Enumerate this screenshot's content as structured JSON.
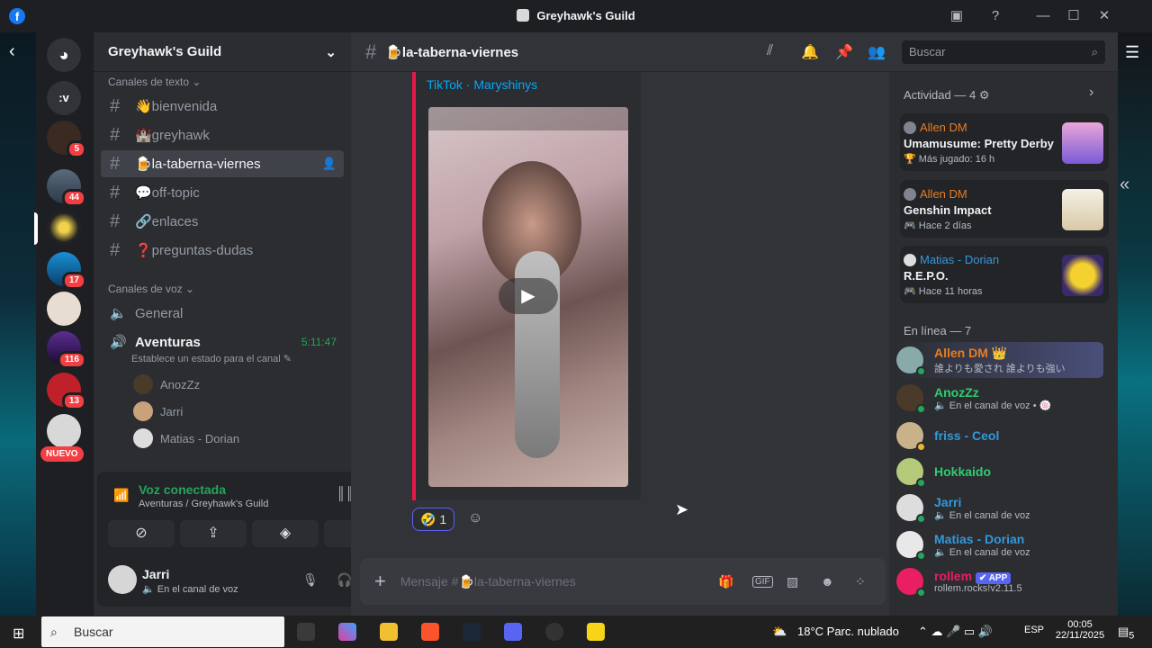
{
  "window": {
    "title": "Greyhawk's Guild",
    "fb": "f"
  },
  "guilds": {
    "home_label": ":v",
    "badges": [
      "5",
      "44",
      "17",
      "116",
      "13"
    ],
    "new_label": "NUEVO"
  },
  "sidebar": {
    "guild_name": "Greyhawk's Guild",
    "text_category": "Canales de texto",
    "text_channels": [
      "👋bienvenida",
      "🏰greyhawk",
      "🍺la-taberna-viernes",
      "💬off-topic",
      "🔗enlaces",
      "❓preguntas-dudas"
    ],
    "voice_category": "Canales de voz",
    "voice_channels": [
      "General",
      "Aventuras"
    ],
    "voice_timer": "5:11:47",
    "voice_status": "Establece un estado para el canal",
    "voice_users": [
      "AnozZz",
      "Jarri",
      "Matias - Dorian"
    ],
    "voice_connected": "Voz conectada",
    "voice_location": "Aventuras / Greyhawk's Guild",
    "user_name": "Jarri",
    "user_status": "En el canal de voz"
  },
  "header": {
    "channel": "🍺la-taberna-viernes",
    "search_placeholder": "Buscar"
  },
  "message": {
    "embed_provider": "TikTok · Maryshinys",
    "reaction_emoji": "🤣",
    "reaction_count": "1",
    "composer_placeholder": "Mensaje #🍺la-taberna-viernes"
  },
  "activity": {
    "title": "Actividad — 4",
    "items": [
      {
        "user": "Allen DM",
        "title": "Umamusume: Pretty Derby",
        "sub": "🏆 Más jugado: 16 h"
      },
      {
        "user": "Allen DM",
        "title": "Genshin Impact",
        "sub": "🎮 Hace 2 días"
      },
      {
        "user": "Matias - Dorian",
        "title": "R.E.P.O.",
        "sub": "🎮 Hace 11 horas"
      }
    ]
  },
  "online": {
    "title": "En línea — 7",
    "members": [
      {
        "name": "Allen DM 👑",
        "sub": "誰よりも愛され 誰よりも強い",
        "color": "#e67e22"
      },
      {
        "name": "AnozZz",
        "sub": "🔈 En el canal de voz • 🍥",
        "color": "#2ecc71"
      },
      {
        "name": "friss - Ceol",
        "sub": "",
        "color": "#3498db"
      },
      {
        "name": "Hokkaido",
        "sub": "",
        "color": "#2ecc71"
      },
      {
        "name": "Jarri",
        "sub": "🔈 En el canal de voz",
        "color": "#3498db"
      },
      {
        "name": "Matias - Dorian",
        "sub": "🔈 En el canal de voz",
        "color": "#3498db"
      },
      {
        "name": "rollem",
        "sub": "rollem.rocks!v2.11.5",
        "color": "#e91e63",
        "tag": "✔ APP"
      }
    ]
  },
  "taskbar": {
    "search": "Buscar",
    "weather": "18°C  Parc. nublado",
    "lang": "ESP",
    "time": "00:05",
    "date": "22/11/2025",
    "notif": "5"
  }
}
